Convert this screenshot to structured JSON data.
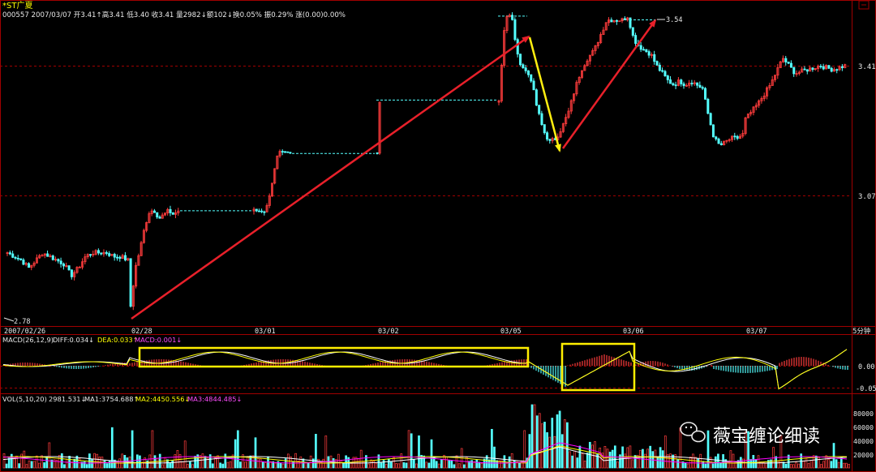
{
  "header": {
    "name": "*ST广夏",
    "line2": "000557 2007/03/07 开3.41↑高3.41 低3.40 收3.41 量2982↓额102↓换0.05% 振0.29% 涨(0.00)0.00%"
  },
  "price_axis": {
    "labels": [
      "3.41",
      "3.07"
    ]
  },
  "annotations": {
    "high_label": "3.54",
    "low_label": "2.78"
  },
  "date_axis": {
    "labels": [
      "2007/02/26",
      "02/28",
      "03/01",
      "03/02",
      "03/05",
      "03/06",
      "03/07"
    ],
    "period": "5分钟"
  },
  "macd": {
    "title": "MACD(26,12,9)",
    "diff": "DIFF:0.034↓",
    "dea": "DEA:0.033↑",
    "macd": "MACD:0.001↓",
    "axis": [
      "0.00",
      "-0.05"
    ]
  },
  "volume": {
    "title": "VOL(5,10,20)",
    "value": "2981.531↓",
    "ma1": "MA1:3754.688↑",
    "ma2": "MA2:4450.556↓",
    "ma3": "MA3:4844.485↓",
    "axis": [
      "80000",
      "60000",
      "40000",
      "20000"
    ]
  },
  "watermark": {
    "text": "薇宝缠论细读"
  },
  "colors": {
    "background": "#000000",
    "up": "#ff3c3c",
    "down": "#54ffff",
    "frame": "#a00000",
    "arrow_red": "#e8202a",
    "arrow_yellow": "#ffee10",
    "highlight_box": "#ffee00",
    "diff_line": "#ffffff",
    "dea_line": "#ffff00",
    "ma1": "#ffffff",
    "ma2": "#ffff00",
    "ma3": "#ff00ff"
  },
  "chart_data": {
    "type": "candlestick",
    "title": "*ST广夏",
    "ylim": [
      2.78,
      3.54
    ],
    "legs": [
      {
        "label": "up",
        "from": {
          "date": "02/28",
          "price": 2.78
        },
        "to": {
          "date": "03/05",
          "price": 3.54
        }
      },
      {
        "label": "down",
        "from": {
          "date": "03/05",
          "price": 3.54
        },
        "to": {
          "date": "03/05",
          "price": 3.2
        }
      },
      {
        "label": "up",
        "from": {
          "date": "03/05",
          "price": 3.2
        },
        "to": {
          "date": "03/06",
          "price": 3.54
        }
      }
    ],
    "price_path": [
      [
        "2007/02/26",
        2.92
      ],
      [
        "2007/02/26",
        2.91
      ],
      [
        "2007/02/26",
        2.9
      ],
      [
        "2007/02/26",
        2.88
      ],
      [
        "2007/02/26",
        2.9
      ],
      [
        "2007/02/26",
        2.92
      ],
      [
        "2007/02/26",
        2.91
      ],
      [
        "2007/02/26",
        2.9
      ],
      [
        "2007/02/26",
        2.89
      ],
      [
        "2007/02/26",
        2.86
      ],
      [
        "2007/02/26",
        2.88
      ],
      [
        "2007/02/26",
        2.91
      ],
      [
        "2007/02/26",
        2.92
      ],
      [
        "2007/02/26",
        2.92
      ],
      [
        "2007/02/26",
        2.92
      ],
      [
        "2007/02/26",
        2.91
      ],
      [
        "2007/02/26",
        2.91
      ],
      [
        "2007/02/26",
        2.9
      ],
      [
        "02/28",
        2.78
      ],
      [
        "02/28",
        2.88
      ],
      [
        "02/28",
        2.93
      ],
      [
        "02/28",
        2.99
      ],
      [
        "02/28",
        3.03
      ],
      [
        "02/28",
        3.03
      ],
      [
        "02/28",
        3.01
      ],
      [
        "02/28",
        3.02
      ],
      [
        "02/28",
        3.03
      ],
      [
        "02/28",
        3.02
      ],
      [
        "02/28",
        3.03
      ],
      [
        "03/01",
        3.03
      ],
      [
        "03/01",
        3.03
      ],
      [
        "03/01",
        3.18
      ],
      [
        "03/01",
        3.18
      ],
      [
        "03/02",
        3.18
      ],
      [
        "03/02",
        3.32
      ],
      [
        "03/02",
        3.32
      ],
      [
        "03/05",
        3.32
      ],
      [
        "03/05",
        3.54
      ],
      [
        "03/05",
        3.54
      ],
      [
        "03/05",
        3.43
      ],
      [
        "03/05",
        3.4
      ],
      [
        "03/05",
        3.38
      ],
      [
        "03/05",
        3.3
      ],
      [
        "03/05",
        3.24
      ],
      [
        "03/05",
        3.21
      ],
      [
        "03/05",
        3.22
      ],
      [
        "03/05",
        3.25
      ],
      [
        "03/05",
        3.29
      ],
      [
        "03/05",
        3.35
      ],
      [
        "03/05",
        3.4
      ],
      [
        "03/05",
        3.43
      ],
      [
        "03/05",
        3.45
      ],
      [
        "03/05",
        3.49
      ],
      [
        "03/05",
        3.53
      ],
      [
        "03/05",
        3.53
      ],
      [
        "03/05",
        3.53
      ],
      [
        "03/06",
        3.53
      ],
      [
        "03/06",
        3.54
      ],
      [
        "03/06",
        3.48
      ],
      [
        "03/06",
        3.46
      ],
      [
        "03/06",
        3.45
      ],
      [
        "03/06",
        3.44
      ],
      [
        "03/06",
        3.41
      ],
      [
        "03/06",
        3.39
      ],
      [
        "03/06",
        3.37
      ],
      [
        "03/06",
        3.36
      ],
      [
        "03/06",
        3.37
      ],
      [
        "03/06",
        3.36
      ],
      [
        "03/06",
        3.37
      ],
      [
        "03/06",
        3.36
      ],
      [
        "03/06",
        3.35
      ],
      [
        "03/06",
        3.28
      ],
      [
        "03/06",
        3.22
      ],
      [
        "03/06",
        3.2
      ],
      [
        "03/06",
        3.21
      ],
      [
        "03/06",
        3.22
      ],
      [
        "03/06",
        3.22
      ],
      [
        "03/06",
        3.23
      ],
      [
        "03/07",
        3.27
      ],
      [
        "03/07",
        3.31
      ],
      [
        "03/07",
        3.36
      ],
      [
        "03/07",
        3.43
      ],
      [
        "03/07",
        3.39
      ],
      [
        "03/07",
        3.4
      ],
      [
        "03/07",
        3.41
      ],
      [
        "03/07",
        3.4
      ],
      [
        "03/07",
        3.41
      ]
    ],
    "macd_highlight_boxes": [
      {
        "from": "02/28",
        "to": "03/05"
      },
      {
        "from": "03/05",
        "to": "03/06"
      }
    ]
  }
}
